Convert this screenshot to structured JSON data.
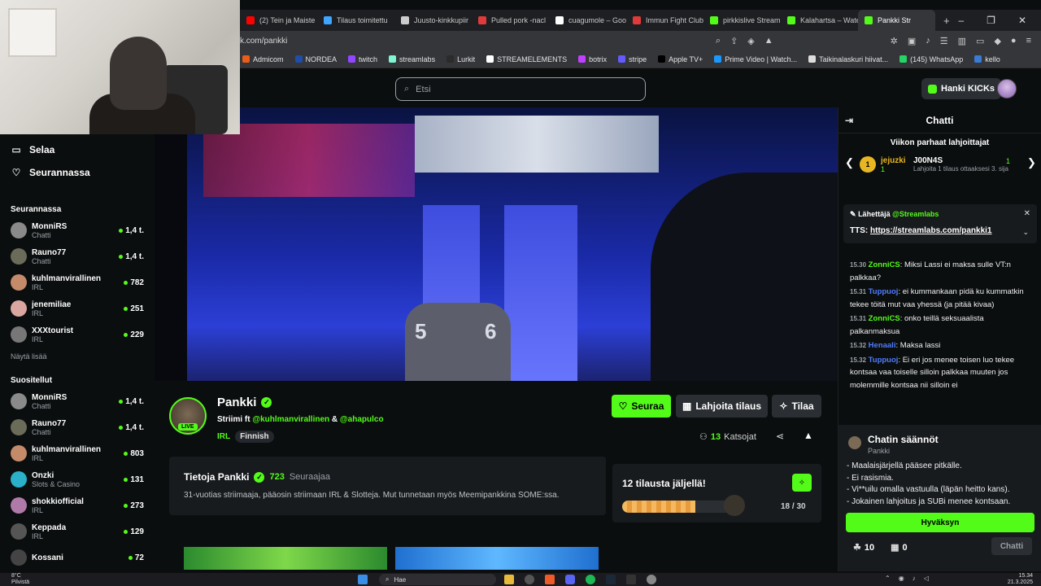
{
  "browser": {
    "tabs": [
      {
        "label": "(2) Tein ja Maiste",
        "color": "#ff0000"
      },
      {
        "label": "Tilaus toimitettu",
        "color": "#3ea6ff"
      },
      {
        "label": "Juusto-kinkkupiir",
        "color": "#cccccc"
      },
      {
        "label": "Pulled pork -nacl",
        "color": "#e03a3a"
      },
      {
        "label": "cuagumole – Goo",
        "color": "#ffffff"
      },
      {
        "label": "Immun Fight Club",
        "color": "#e03a3a"
      },
      {
        "label": "pirkkislive Stream",
        "color": "#53fc18"
      },
      {
        "label": "Kalahartsa – Wate",
        "color": "#53fc18"
      },
      {
        "label": "Pankki Str",
        "color": "#53fc18"
      }
    ],
    "new_tab": "+",
    "window_controls": [
      "–",
      "❐",
      "✕"
    ],
    "url": "k.com/pankki",
    "bookmarks": [
      {
        "label": "Admicom",
        "color": "#e85d1a"
      },
      {
        "label": "NORDEA",
        "color": "#1e4ea8"
      },
      {
        "label": "twitch",
        "color": "#9146ff"
      },
      {
        "label": "streamlabs",
        "color": "#80f5d2"
      },
      {
        "label": "Lurkit",
        "color": "#2b2b2b"
      },
      {
        "label": "STREAMELEMENTS",
        "color": "#ffffff"
      },
      {
        "label": "botrix",
        "color": "#c040ff"
      },
      {
        "label": "stripe",
        "color": "#635bff"
      },
      {
        "label": "Apple TV+",
        "color": "#000000"
      },
      {
        "label": "Prime Video | Watch...",
        "color": "#1a98ff"
      },
      {
        "label": "Taikinalaskuri hiivat...",
        "color": "#dddddd"
      },
      {
        "label": "(145) WhatsApp",
        "color": "#25d366"
      },
      {
        "label": "kello",
        "color": "#3a7bd5"
      }
    ]
  },
  "header": {
    "search_placeholder": "Etsi",
    "get_kicks": "Hanki KICKs"
  },
  "sidebar": {
    "nav": [
      {
        "label": "Selaa",
        "icon": "browse-icon"
      },
      {
        "label": "Seurannassa",
        "icon": "heart-icon"
      }
    ],
    "following_title": "Seurannassa",
    "following": [
      {
        "name": "MonniRS",
        "category": "Chatti",
        "viewers": "1,4 t.",
        "color": "#8a8a8a"
      },
      {
        "name": "Rauno77",
        "category": "Chatti",
        "viewers": "1,4 t.",
        "color": "#6b6b5a"
      },
      {
        "name": "kuhlmanvirallinen",
        "category": "IRL",
        "viewers": "782",
        "color": "#c48a6a"
      },
      {
        "name": "jenemiliae",
        "category": "IRL",
        "viewers": "251",
        "color": "#d9a7a0"
      },
      {
        "name": "XXXtourist",
        "category": "IRL",
        "viewers": "229",
        "color": "#777777"
      }
    ],
    "show_more": "Näytä lisää",
    "recommended_title": "Suositellut",
    "recommended": [
      {
        "name": "MonniRS",
        "category": "Chatti",
        "viewers": "1,4 t.",
        "color": "#8a8a8a"
      },
      {
        "name": "Rauno77",
        "category": "Chatti",
        "viewers": "1,4 t.",
        "color": "#6b6b5a"
      },
      {
        "name": "kuhlmanvirallinen",
        "category": "IRL",
        "viewers": "803",
        "color": "#c48a6a"
      },
      {
        "name": "Onzki",
        "category": "Slots & Casino",
        "viewers": "131",
        "color": "#2ab0c8"
      },
      {
        "name": "shokkiofficial",
        "category": "IRL",
        "viewers": "273",
        "color": "#b07aa8"
      },
      {
        "name": "Keppada",
        "category": "IRL",
        "viewers": "129",
        "color": "#555555"
      },
      {
        "name": "Kossani",
        "category": "",
        "viewers": "72",
        "color": "#444444"
      }
    ]
  },
  "video": {
    "lane_number_left": "5",
    "lane_number_right": "6"
  },
  "stream": {
    "name": "Pankki",
    "live": "LIVE",
    "title_prefix": "Striimi ft",
    "collab1": "@kuhlmanvirallinen",
    "amp": "&",
    "collab2": "@ahapulco",
    "category": "IRL",
    "tag": "Finnish",
    "follow": "Seuraa",
    "gift": "Lahjoita tilaus",
    "subscribe": "Tilaa",
    "viewers": "13",
    "viewers_label": "Katsojat"
  },
  "about": {
    "title": "Tietoja Pankki",
    "followers": "723",
    "followers_label": "Seuraajaa",
    "description": "31-vuotias striimaaja, pääosin striimaan IRL & Slotteja. Mut tunnetaan myös Meemipankkina SOME:ssa."
  },
  "subgoal": {
    "title": "12 tilausta jäljellä!",
    "progress_text": "18 / 30",
    "progress": 0.6
  },
  "chat": {
    "title": "Chatti",
    "top_gifters_title": "Viikon parhaat lahjoittajat",
    "gifter1": {
      "name": "jejuzki",
      "count": "1",
      "rank": "1"
    },
    "gifter2": {
      "name": "J00N4S",
      "note": "Lahjoita 1 tilaus ottaaksesi 3. sija"
    },
    "gifter3_count": "1",
    "pinned_by": "Lähettäjä",
    "pinned_author": "@Streamlabs",
    "pinned_text_prefix": "TTS:",
    "pinned_link": "https://streamlabs.com/pankki1",
    "messages": [
      {
        "time": "15.30",
        "user": "ZonniCS",
        "color": "#53fc18",
        "text": "Miksi Lassi ei maksa sulle VT:n palkkaa?"
      },
      {
        "time": "15.31",
        "user": "Tuppuoj",
        "color": "#4f7cff",
        "text": "ei kummankaan pidä ku kummatkin tekee töitä mut vaa yhessä (ja pitää kivaa)"
      },
      {
        "time": "15.31",
        "user": "ZonniCS",
        "color": "#53fc18",
        "text": "onko teillä seksuaalista palkanmaksua"
      },
      {
        "time": "15.32",
        "user": "Henaali",
        "color": "#4f7cff",
        "text": "Maksa lassi"
      },
      {
        "time": "15.32",
        "user": "Tuppuoj",
        "color": "#4f7cff",
        "text": "Ei eri jos menee toisen luo tekee kontsaa vaa toiselle silloin palkkaa muuten jos molemmille kontsaa nii silloin ei"
      }
    ],
    "rules_title": "Chatin säännöt",
    "rules_subtitle": "Pankki",
    "rules": [
      "- Maalaisjärjellä pääsee pitkälle.",
      "- Ei rasismia.",
      "- Vi**uilu omalla vastuulla (läpän heitto kans).",
      "- Jokainen lahjoitus ja SUBi menee kontsaan."
    ],
    "accept": "Hyväksyn",
    "kicks_count": "10",
    "gifts_count": "0",
    "send": "Chatti"
  },
  "taskbar": {
    "weather_temp": "8°C",
    "weather_desc": "Pilvistä",
    "search": "Hae",
    "time": "15.34",
    "date": "21.3.2025"
  }
}
